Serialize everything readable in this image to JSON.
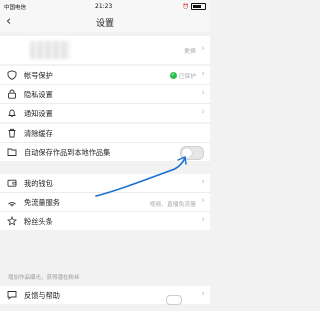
{
  "status_bar": {
    "carrier": "中国电信",
    "time": "21:23",
    "battery": "■"
  },
  "nav": {
    "back_icon": "chevron-left-icon",
    "title": "设置"
  },
  "profile": {
    "right_text": "更换"
  },
  "group1": [
    {
      "icon": "shield-icon",
      "label": "帐号保护",
      "status": "已保护"
    },
    {
      "icon": "lock-icon",
      "label": "隐私设置"
    },
    {
      "icon": "bell-icon",
      "label": "通知设置"
    }
  ],
  "group2": [
    {
      "icon": "trash-icon",
      "label": "清除缓存"
    },
    {
      "icon": "folder-icon",
      "label": "自动保存作品到本地作品集",
      "toggle_on": false
    }
  ],
  "group3": [
    {
      "icon": "wallet-icon",
      "label": "我的钱包"
    },
    {
      "icon": "signal-icon",
      "label": "免流量服务",
      "right_text": "视频、直播免流量"
    },
    {
      "icon": "star-icon",
      "label": "粉丝头条"
    }
  ],
  "hint_text": "增加作品曝光，获得潜在粉丝",
  "group4": [
    {
      "icon": "feedback-icon",
      "label": "反馈与帮助"
    }
  ],
  "colors": {
    "accent_green": "#2bbf4f",
    "annotation_blue": "#1a6fd1"
  }
}
